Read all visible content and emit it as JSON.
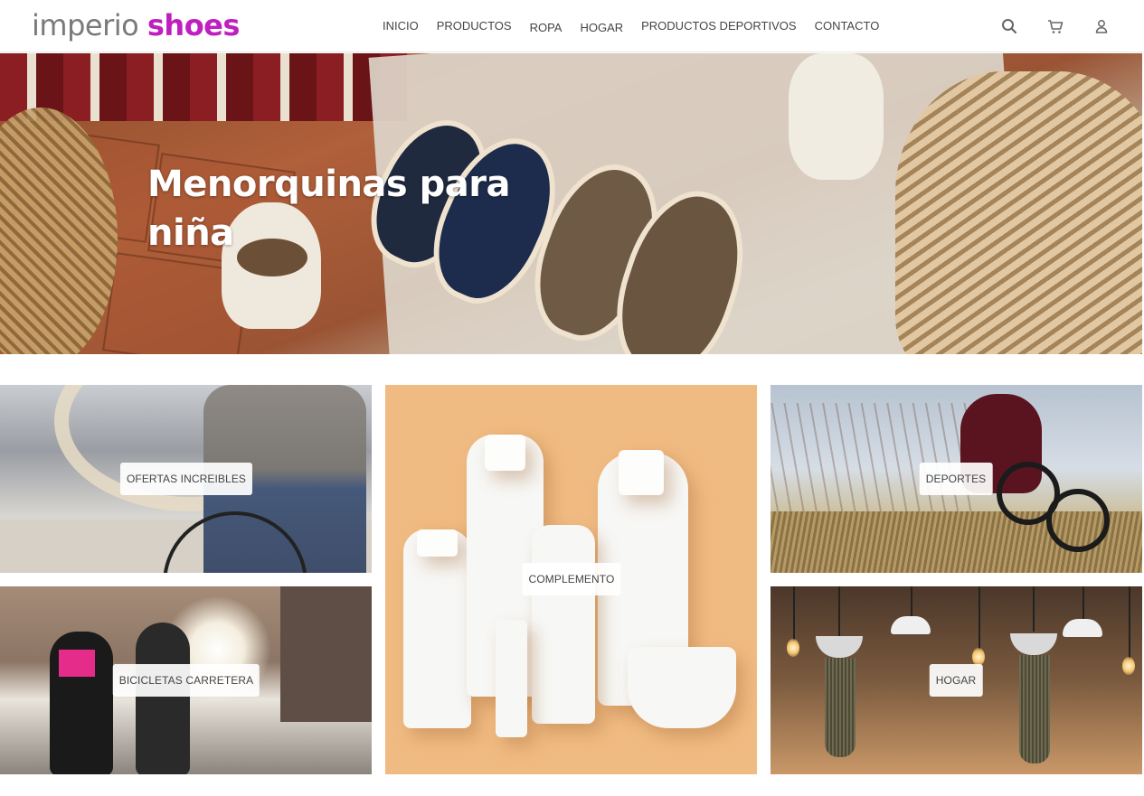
{
  "header": {
    "logo_part1": "imperio",
    "logo_part2": "shoes",
    "nav": [
      "INICIO",
      "PRODUCTOS",
      "ROPA",
      "HOGAR",
      "PRODUCTOS DEPORTIVOS",
      "CONTACTO"
    ],
    "icons": [
      "search-icon",
      "cart-icon",
      "user-icon"
    ]
  },
  "hero": {
    "title": "Menorquinas para niña"
  },
  "categories": {
    "ofertas": "OFERTAS INCREIBLES",
    "bicicletas": "BICICLETAS CARRETERA",
    "complemento": "COMPLEMENTO",
    "deportes": "DEPORTES",
    "hogar": "HOGAR"
  },
  "colors": {
    "brand_accent": "#bf1fbf",
    "logo_gray": "#7a7a7a"
  }
}
